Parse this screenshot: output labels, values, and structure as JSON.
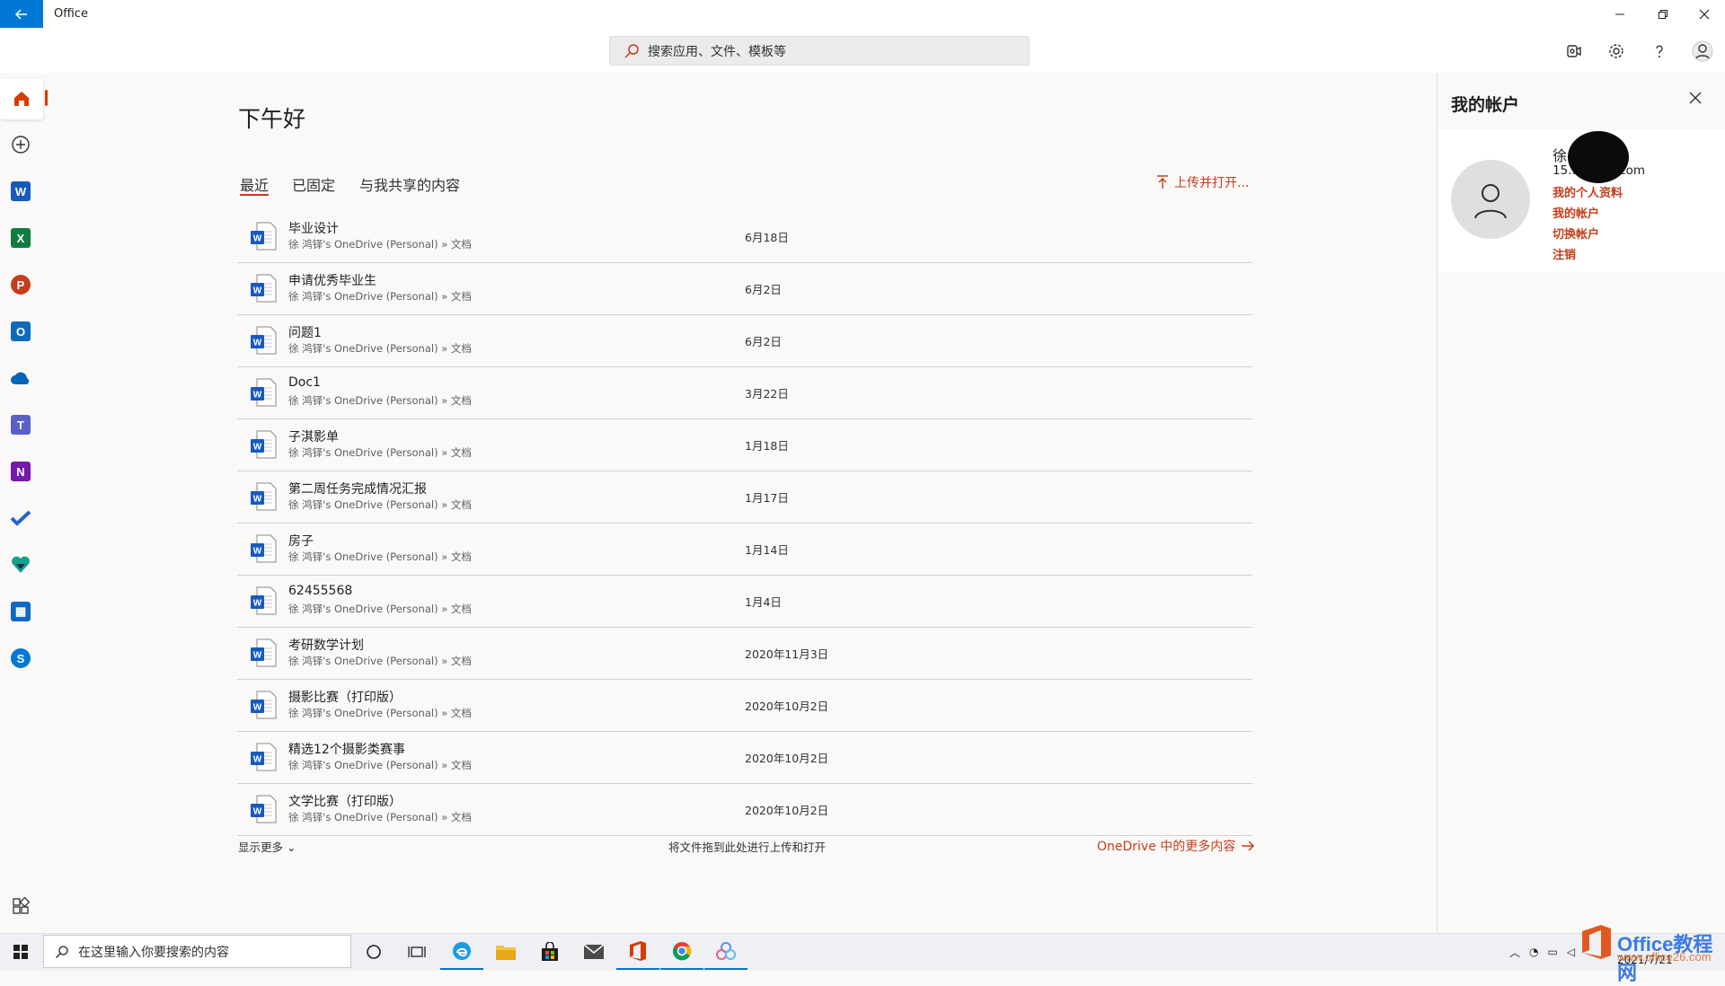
{
  "window": {
    "title": "Office"
  },
  "search": {
    "placeholder": "搜索应用、文件、模板等"
  },
  "greeting": "下午好",
  "tabs": [
    {
      "label": "最近",
      "active": true
    },
    {
      "label": "已固定"
    },
    {
      "label": "与我共享的内容"
    }
  ],
  "upload_open_label": "上传并打开...",
  "files": [
    {
      "name": "毕业设计",
      "path": "徐 鸿铎's OneDrive (Personal) » 文档",
      "date": "6月18日"
    },
    {
      "name": "申请优秀毕业生",
      "path": "徐 鸿铎's OneDrive (Personal) » 文档",
      "date": "6月2日"
    },
    {
      "name": "问题1",
      "path": "徐 鸿铎's OneDrive (Personal) » 文档",
      "date": "6月2日"
    },
    {
      "name": "Doc1",
      "path": "徐 鸿铎's OneDrive (Personal) » 文档",
      "date": "3月22日"
    },
    {
      "name": "子淇影单",
      "path": "徐 鸿铎's OneDrive (Personal) » 文档",
      "date": "1月18日"
    },
    {
      "name": "第二周任务完成情况汇报",
      "path": "徐 鸿铎's OneDrive (Personal) » 文档",
      "date": "1月17日"
    },
    {
      "name": "房子",
      "path": "徐 鸿铎's OneDrive (Personal) » 文档",
      "date": "1月14日"
    },
    {
      "name": "62455568",
      "path": "徐 鸿铎's OneDrive (Personal) » 文档",
      "date": "1月4日"
    },
    {
      "name": "考研数学计划",
      "path": "徐 鸿铎's OneDrive (Personal) » 文档",
      "date": "2020年11月3日"
    },
    {
      "name": "摄影比赛（打印版）",
      "path": "徐 鸿铎's OneDrive (Personal) » 文档",
      "date": "2020年10月2日"
    },
    {
      "name": "精选12个摄影类赛事",
      "path": "徐 鸿铎's OneDrive (Personal) » 文档",
      "date": "2020年10月2日"
    },
    {
      "name": "文学比赛（打印版）",
      "path": "徐 鸿铎's OneDrive (Personal) » 文档",
      "date": "2020年10月2日"
    }
  ],
  "footer": {
    "show_more": "显示更多",
    "drop_hint": "将文件拖到此处进行上传和打开",
    "more_onedrive": "OneDrive 中的更多内容"
  },
  "account_panel": {
    "title": "我的帐户",
    "name": "徐",
    "email_visible": "15…@163.com",
    "links": [
      "我的个人资料",
      "我的帐户",
      "切换帐户",
      "注销"
    ]
  },
  "taskbar": {
    "search_placeholder": "在这里输入你要搜索的内容",
    "date": "2021/7/21"
  },
  "watermark": {
    "brand": "Office教程网",
    "url": "www.office26.com"
  },
  "colors": {
    "accent": "#c43e1c",
    "titlebar_back": "#0078d4",
    "word_blue": "#185abd"
  }
}
